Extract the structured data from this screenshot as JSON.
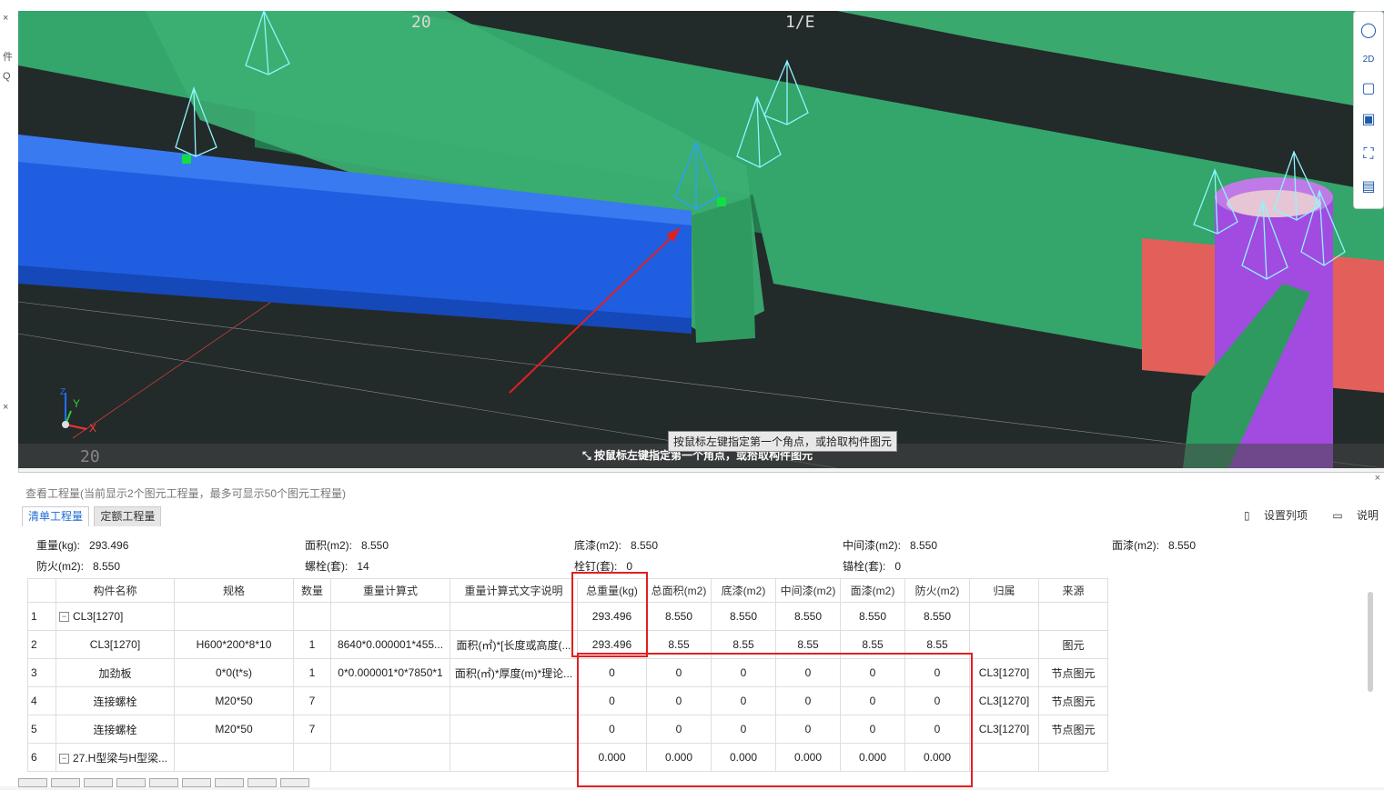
{
  "viewport": {
    "grid_labels": [
      "20",
      "1/E",
      "20"
    ],
    "axis_labels": {
      "x": "X",
      "y": "Y",
      "z": "Z"
    },
    "hint_bar_text": "按鼠标左键指定第一个角点，或拾取构件图元",
    "tooltip_text": "按鼠标左键指定第一个角点，或拾取构件图元",
    "view_tools": [
      "orbit-icon",
      "2d-view-icon",
      "3d-box-icon",
      "3d-solid-box-icon",
      "fit-view-icon",
      "view-settings-icon"
    ],
    "colors": {
      "background": "#232a2a",
      "steel_beam": "#3ca86c",
      "selected_beam": "#1f5ee0",
      "column": "#a24be0",
      "plate": "#e3605a",
      "annotation_arrow": "#e02020"
    }
  },
  "panel": {
    "title": "查看工程量(当前显示2个图元工程量，最多可显示50个图元工程量)",
    "tabs": [
      "清单工程量",
      "定额工程量"
    ],
    "active_tab": 0,
    "tools": {
      "set_columns": "设置列项",
      "help": "说明"
    },
    "summary": [
      {
        "label": "重量(kg):",
        "value": "293.496"
      },
      {
        "label": "面积(m2):",
        "value": "8.550"
      },
      {
        "label": "底漆(m2):",
        "value": "8.550"
      },
      {
        "label": "中间漆(m2):",
        "value": "8.550"
      },
      {
        "label": "面漆(m2):",
        "value": "8.550"
      },
      {
        "label": "防火(m2):",
        "value": "8.550"
      },
      {
        "label": "螺栓(套):",
        "value": "14"
      },
      {
        "label": "栓钉(套):",
        "value": "0"
      },
      {
        "label": "锚栓(套):",
        "value": "0"
      }
    ],
    "table": {
      "headers": [
        "",
        "构件名称",
        "规格",
        "数量",
        "重量计算式",
        "重量计算式文字说明",
        "总重量(kg)",
        "总面积(m2)",
        "底漆(m2)",
        "中间漆(m2)",
        "面漆(m2)",
        "防火(m2)",
        "归属",
        "来源"
      ],
      "rows": [
        [
          "1",
          "CL3[1270]",
          "",
          "",
          "",
          "",
          "293.496",
          "8.550",
          "8.550",
          "8.550",
          "8.550",
          "8.550",
          "",
          ""
        ],
        [
          "2",
          "CL3[1270]",
          "H600*200*8*10",
          "1",
          "8640*0.000001*455...",
          "面积(㎡)*[长度或高度(...",
          "293.496",
          "8.55",
          "8.55",
          "8.55",
          "8.55",
          "8.55",
          "",
          "图元"
        ],
        [
          "3",
          "加劲板",
          "0*0(t*s)",
          "1",
          "0*0.000001*0*7850*1",
          "面积(㎡)*厚度(m)*理论...",
          "0",
          "0",
          "0",
          "0",
          "0",
          "0",
          "CL3[1270]",
          "节点图元"
        ],
        [
          "4",
          "连接螺栓",
          "M20*50",
          "7",
          "",
          "",
          "0",
          "0",
          "0",
          "0",
          "0",
          "0",
          "CL3[1270]",
          "节点图元"
        ],
        [
          "5",
          "连接螺栓",
          "M20*50",
          "7",
          "",
          "",
          "0",
          "0",
          "0",
          "0",
          "0",
          "0",
          "CL3[1270]",
          "节点图元"
        ],
        [
          "6",
          "27.H型梁与H型梁...",
          "",
          "",
          "",
          "",
          "0.000",
          "0.000",
          "0.000",
          "0.000",
          "0.000",
          "0.000",
          "",
          ""
        ]
      ],
      "tree_rows": {
        "1": "−",
        "6": "−"
      }
    }
  },
  "left_panel_glyphs": [
    "×",
    "件",
    "Q",
    "×"
  ]
}
